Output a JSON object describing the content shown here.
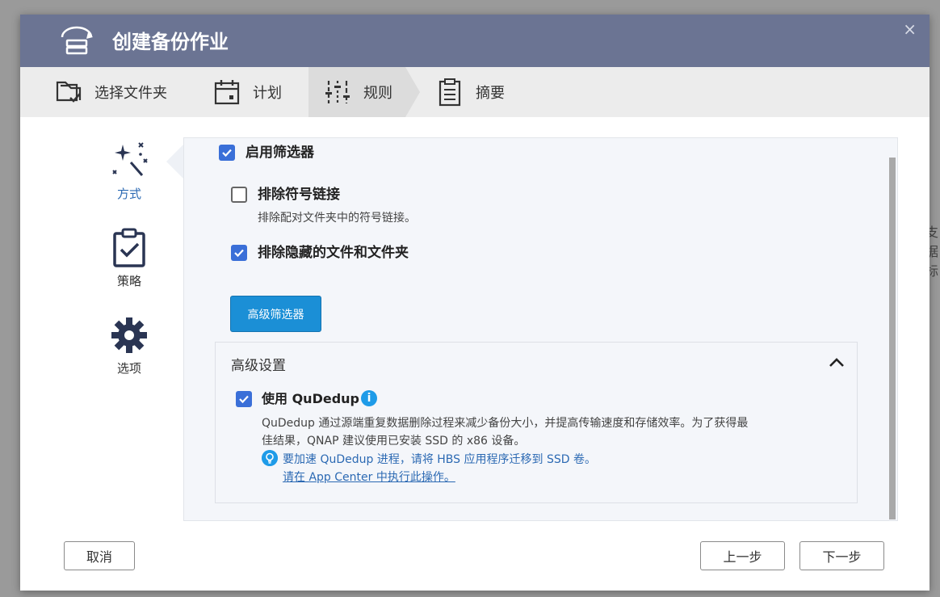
{
  "background": {
    "text": "支\n据\n标"
  },
  "dialog": {
    "title": "创建备份作业",
    "close": "×"
  },
  "steps": [
    {
      "label": "选择文件夹",
      "icon": "folder-check-icon"
    },
    {
      "label": "计划",
      "icon": "calendar-icon"
    },
    {
      "label": "规则",
      "icon": "sliders-icon"
    },
    {
      "label": "摘要",
      "icon": "clipboard-list-icon"
    }
  ],
  "sidenav": [
    {
      "label": "方式",
      "icon": "magic-wand-icon",
      "active": true
    },
    {
      "label": "策略",
      "icon": "clipboard-check-icon"
    },
    {
      "label": "选项",
      "icon": "gear-icon"
    }
  ],
  "filters": {
    "enable_label": "启用筛选器",
    "enable_checked": true,
    "exclude_symlinks_label": "排除符号链接",
    "exclude_symlinks_checked": false,
    "exclude_symlinks_desc": "排除配对文件夹中的符号链接。",
    "exclude_hidden_label": "排除隐藏的文件和文件夹",
    "exclude_hidden_checked": true,
    "advanced_filter_button": "高级筛选器"
  },
  "advanced": {
    "title": "高级设置",
    "qudedup_label": "使用 QuDedup",
    "qudedup_checked": true,
    "qudedup_desc_line1": "QuDedup 通过源端重复数据删除过程来减少备份大小，并提高传输速度和存储效率。为了获得最",
    "qudedup_desc_line2": "佳结果，QNAP 建议使用已安装 SSD 的 x86 设备。",
    "tip_text": "要加速 QuDedup 进程，请将 HBS 应用程序迁移到 SSD 卷。",
    "tip_link": "请在 App Center 中执行此操作。"
  },
  "footer": {
    "cancel": "取消",
    "prev": "上一步",
    "next": "下一步"
  },
  "colors": {
    "title_bar": "#6b7493",
    "primary": "#1b8fd6",
    "checkbox": "#3a6fd8",
    "link": "#2b69b3"
  }
}
